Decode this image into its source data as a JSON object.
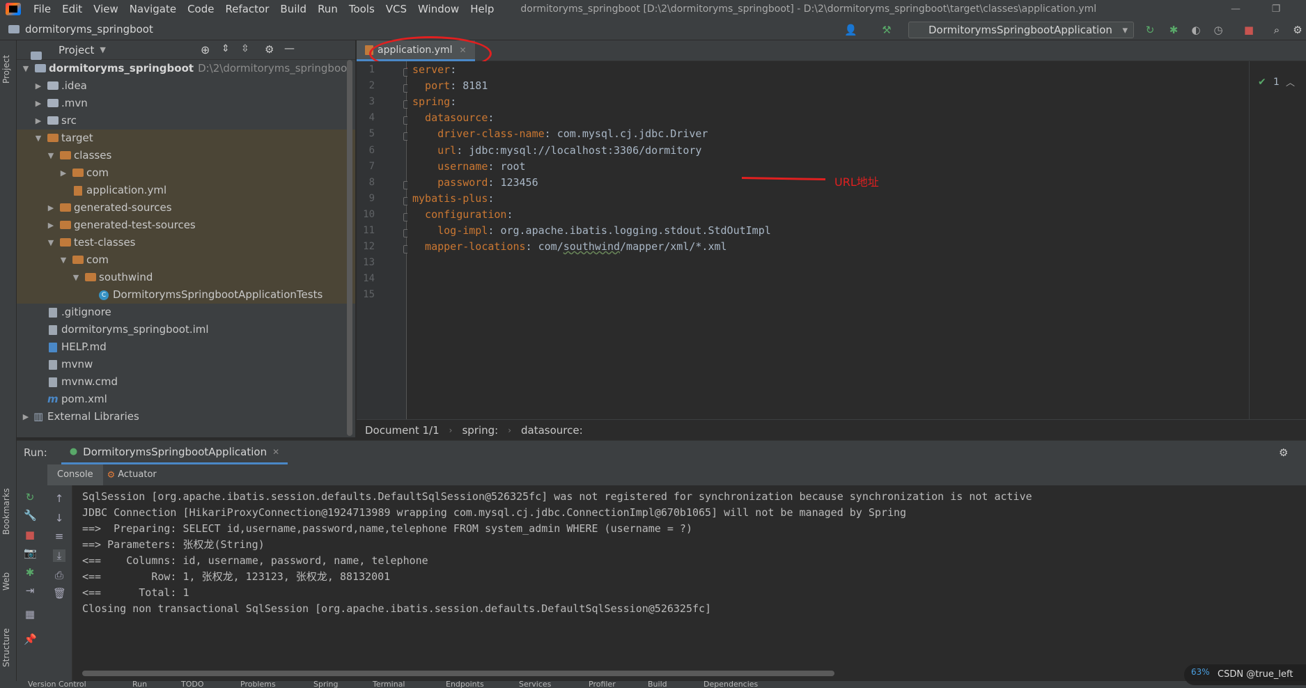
{
  "menubar": {
    "items": [
      "File",
      "Edit",
      "View",
      "Navigate",
      "Code",
      "Refactor",
      "Build",
      "Run",
      "Tools",
      "VCS",
      "Window",
      "Help"
    ],
    "title": "dormitoryms_springboot [D:\\2\\dormitoryms_springboot] - D:\\2\\dormitoryms_springboot\\target\\classes\\application.yml"
  },
  "toolbar": {
    "project_name": "dormitoryms_springboot",
    "run_config": "DormitorymsSpringbootApplication"
  },
  "left_strip": {
    "project": "Project",
    "bookmarks": "Bookmarks",
    "web": "Web",
    "structure": "Structure"
  },
  "project_panel": {
    "title": "Project",
    "tree": [
      {
        "label": "dormitoryms_springboot",
        "path": "D:\\2\\dormitoryms_springboot"
      },
      {
        "label": ".idea"
      },
      {
        "label": ".mvn"
      },
      {
        "label": "src"
      },
      {
        "label": "target"
      },
      {
        "label": "classes"
      },
      {
        "label": "com"
      },
      {
        "label": "application.yml"
      },
      {
        "label": "generated-sources"
      },
      {
        "label": "generated-test-sources"
      },
      {
        "label": "test-classes"
      },
      {
        "label": "com"
      },
      {
        "label": "southwind"
      },
      {
        "label": "DormitorymsSpringbootApplicationTests"
      },
      {
        "label": ".gitignore"
      },
      {
        "label": "dormitoryms_springboot.iml"
      },
      {
        "label": "HELP.md"
      },
      {
        "label": "mvnw"
      },
      {
        "label": "mvnw.cmd"
      },
      {
        "label": "pom.xml"
      },
      {
        "label": "External Libraries"
      }
    ]
  },
  "editor": {
    "tab_label": "application.yml",
    "line_numbers": [
      "1",
      "2",
      "3",
      "4",
      "5",
      "6",
      "7",
      "8",
      "9",
      "10",
      "11",
      "12",
      "13",
      "14",
      "15"
    ],
    "lines": [
      {
        "key": "server",
        "sep": ":",
        "value": ""
      },
      {
        "key": "  port",
        "sep": ": ",
        "value": "8181"
      },
      {
        "key": "spring",
        "sep": ":",
        "value": ""
      },
      {
        "key": "  datasource",
        "sep": ":",
        "value": ""
      },
      {
        "key": "    driver-class-name",
        "sep": ": ",
        "value": "com.mysql.cj.jdbc.Driver"
      },
      {
        "key": "    url",
        "sep": ": ",
        "value": "jdbc:mysql://localhost:3306/dormitory"
      },
      {
        "key": "    username",
        "sep": ": ",
        "value": "root"
      },
      {
        "key": "    password",
        "sep": ": ",
        "value": "123456"
      },
      {
        "key": "mybatis-plus",
        "sep": ":",
        "value": ""
      },
      {
        "key": "  configuration",
        "sep": ":",
        "value": ""
      },
      {
        "key": "    log-impl",
        "sep": ": ",
        "value": "org.apache.ibatis.logging.stdout.StdOutImpl"
      },
      {
        "key": "  mapper-locations",
        "sep": ": ",
        "value_pre": "com/",
        "value_ul": "southwind",
        "value_post": "/mapper/xml/*.xml"
      }
    ],
    "annotation": "URL地址",
    "inspection_count": "1",
    "breadcrumb": [
      "Document 1/1",
      "spring:",
      "datasource:"
    ]
  },
  "run_panel": {
    "label": "Run:",
    "tab": "DormitorymsSpringbootApplication",
    "subtabs": [
      "Console",
      "Actuator"
    ],
    "console_lines": [
      "SqlSession [org.apache.ibatis.session.defaults.DefaultSqlSession@526325fc] was not registered for synchronization because synchronization is not active",
      "JDBC Connection [HikariProxyConnection@1924713989 wrapping com.mysql.cj.jdbc.ConnectionImpl@670b1065] will not be managed by Spring",
      "==>  Preparing: SELECT id,username,password,name,telephone FROM system_admin WHERE (username = ?)",
      "==> Parameters: 张权龙(String)",
      "<==    Columns: id, username, password, name, telephone",
      "<==        Row: 1, 张权龙, 123123, 张权龙, 88132001",
      "<==      Total: 1",
      "Closing non transactional SqlSession [org.apache.ibatis.session.defaults.DefaultSqlSession@526325fc]"
    ]
  },
  "status_bar": {
    "items": [
      "Version Control",
      "Run",
      "TODO",
      "Problems",
      "Spring",
      "Terminal",
      "Endpoints",
      "Services",
      "Profiler",
      "Build",
      "Dependencies"
    ]
  },
  "watermark": {
    "text": "CSDN @true_left",
    "pct": "63%"
  },
  "colors": {
    "accent": "#4a88c7",
    "annotation": "#e02020",
    "yaml_key": "#cc7832"
  }
}
